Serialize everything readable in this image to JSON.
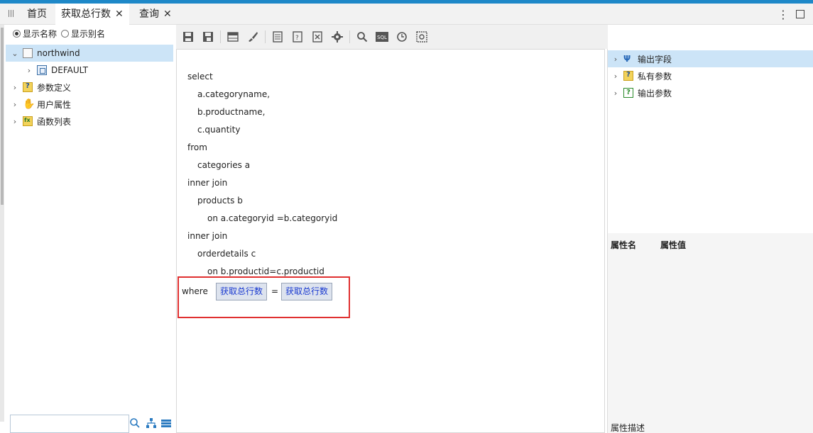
{
  "tabs": [
    {
      "label": "首页",
      "closable": false,
      "active": false
    },
    {
      "label": "获取总行数",
      "closable": true,
      "active": true
    },
    {
      "label": "查询",
      "closable": true,
      "active": false
    }
  ],
  "tab_menu_icon": "⋮",
  "left": {
    "radio_show_name": "显示名称",
    "radio_show_alias": "显示别名",
    "tree": {
      "root": "northwind",
      "schema": "DEFAULT",
      "param_def": "参数定义",
      "user_attr": "用户属性",
      "func_list": "函数列表"
    }
  },
  "sql": {
    "l1": "select",
    "l2": "a.categoryname,",
    "l3": "b.productname,",
    "l4": "c.quantity",
    "l5": "from",
    "l6": "categories a",
    "l7": "inner join",
    "l8": "products b",
    "l9": "on a.categoryid =b.categoryid",
    "l10": "inner join",
    "l11": "orderdetails c",
    "l12": "on b.productid=c.productid",
    "where_kw": "where",
    "param_left": "获取总行数",
    "equals": "=",
    "param_right": "获取总行数"
  },
  "right": {
    "output_fields": "输出字段",
    "private_params": "私有参数",
    "output_params": "输出参数",
    "prop_name": "属性名",
    "prop_value": "属性值",
    "prop_desc": "属性描述"
  },
  "colors": {
    "accent": "#1e88c8",
    "selection": "#cce4f7",
    "highlight_box": "#e03030",
    "param_chip_text": "#1a3ad0"
  }
}
